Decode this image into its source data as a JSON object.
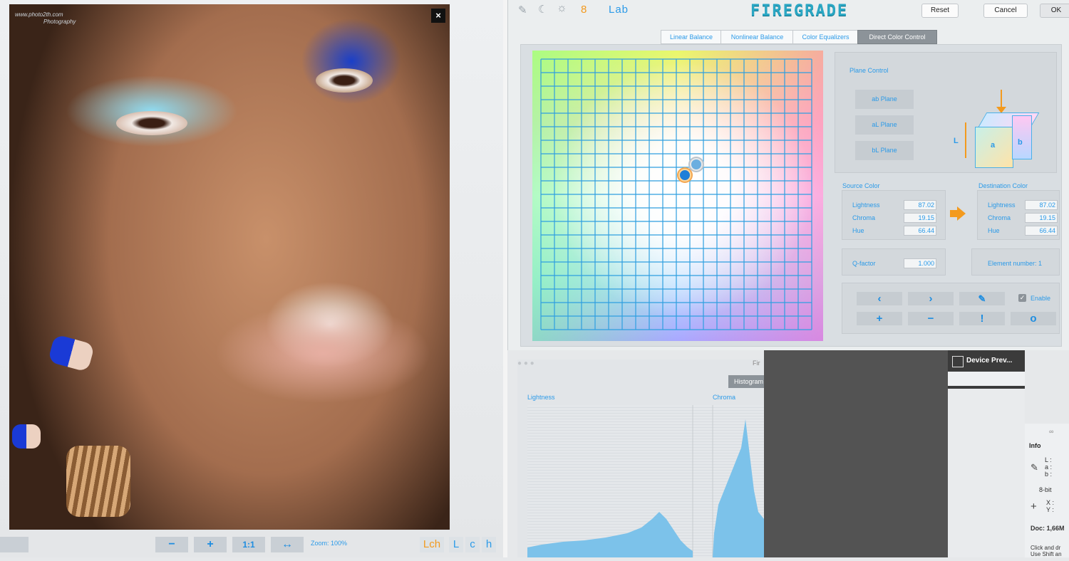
{
  "preview": {
    "close_icon": "×",
    "watermark_line1": "www.photo2th.com",
    "watermark_line2": "Photography",
    "zoom": "Zoom: 100%",
    "toolbar": {
      "minus": "−",
      "plus": "+",
      "one_to_one": "1:1",
      "fit": "↔"
    },
    "modes": [
      "Lch",
      "L",
      "c",
      "h"
    ]
  },
  "dialog": {
    "top_icons": {
      "bit_depth": "8",
      "colorspace": "Lab"
    },
    "brand": "FIREGRADE",
    "buttons": {
      "reset": "Reset",
      "cancel": "Cancel",
      "ok": "OK"
    },
    "tabs": [
      "Linear Balance",
      "Nonlinear Balance",
      "Color Equalizers",
      "Direct Color Control"
    ],
    "active_tab": 3,
    "plane_control": {
      "title": "Plane Control",
      "buttons": [
        "ab Plane",
        "aL Plane",
        "bL Plane"
      ],
      "cube_labels": {
        "l": "L",
        "a": "a",
        "b": "b"
      }
    },
    "source": {
      "title": "Source Color",
      "lightness_label": "Lightness",
      "lightness": "87.02",
      "chroma_label": "Chroma",
      "chroma": "19.15",
      "hue_label": "Hue",
      "hue": "66.44"
    },
    "destination": {
      "title": "Destination Color",
      "lightness_label": "Lightness",
      "lightness": "87.02",
      "chroma_label": "Chroma",
      "chroma": "19.15",
      "hue_label": "Hue",
      "hue": "66.44"
    },
    "qfactor": {
      "label": "Q-factor",
      "value": "1.000"
    },
    "element_number": "Element number: 1",
    "controls": {
      "prev": "‹",
      "next": "›",
      "add": "+",
      "remove": "−",
      "alert": "!",
      "circle": "o",
      "enable_label": "Enable"
    }
  },
  "histogram": {
    "tab": "Histogram",
    "lightness": "Lightness",
    "chroma": "Chroma",
    "window_title": "Fir"
  },
  "photoshop": {
    "device_preview": "Device Prev...",
    "info_tab": "Info",
    "lab_readout": "L :\na :\nb :",
    "bits": "8-bit",
    "xy_readout": "X :\nY :",
    "doc": "Doc: 1,66M",
    "hint1": "Click and dr",
    "hint2": "Use Shift an"
  },
  "colors": {
    "accent": "#2b9ae8",
    "orange": "#f39a1e",
    "brand": "#2aa7c4"
  }
}
